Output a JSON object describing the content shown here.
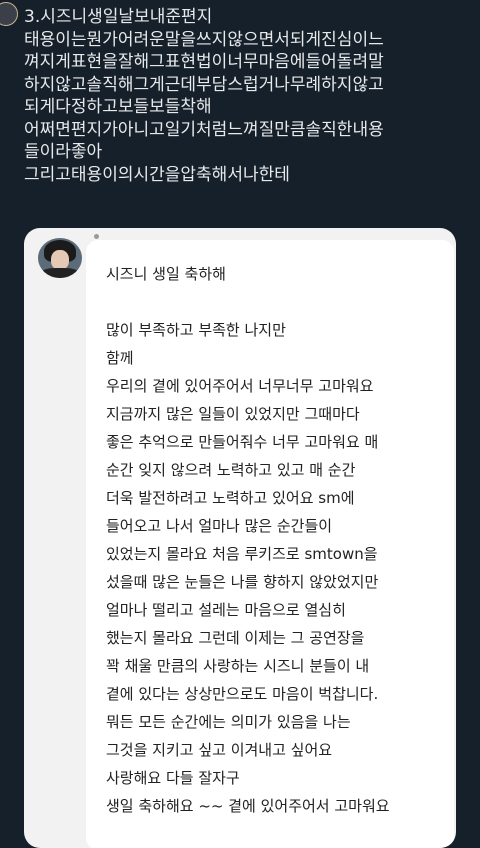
{
  "tweet": {
    "lines": [
      "3.시즈니생일날보내준편지",
      "태용이는뭔가어려운말을쓰지않으면서되게진심이느",
      "껴지게표현을잘해그표현법이너무마음에들어돌려말",
      "하지않고솔직해그게근데부담스럽거나무례하지않고",
      "되게다정하고보들보들착해",
      "어쩌면편지가아니고일기처럼느껴질만큼솔직한내용",
      "들이라좋아",
      "그리고태용이의시간을압축해서나한테"
    ]
  },
  "letter": {
    "title": "시즈니 생일 축하해",
    "lines": [
      "",
      "많이 부족하고 부족한 나지만",
      "함께",
      "우리의 곁에 있어주어서 너무너무 고마워요",
      "지금까지 많은 일들이 있었지만 그때마다",
      "좋은 추억으로 만들어줘수 너무 고마워요 매",
      "순간 잊지 않으려 노력하고 있고 매 순간",
      "더욱 발전하려고 노력하고 있어요 sm에",
      "들어오고 나서 얼마나 많은 순간들이",
      "있었는지 몰라요 처음 루키즈로 smtown을",
      "섰을때 많은 눈들은 나를 향하지 않았었지만",
      "얼마나 떨리고 설레는 마음으로 열심히",
      "했는지 몰라요 그런데 이제는 그 공연장을",
      "꽉 채울 만큼의 사랑하는 시즈니 분들이 내",
      "곁에 있다는 상상만으로도 마음이 벅찹니다.",
      "뭐든 모든 순간에는 의미가 있음을 나는",
      "그것을 지키고 싶고 이겨내고 싶어요",
      "사랑해요 다들 잘자구",
      "생일 축하해요 ~~ 곁에 있어주어서 고마워요"
    ]
  },
  "icons": {
    "profile_avatar": "avatar",
    "letter_avatar": "avatar"
  }
}
